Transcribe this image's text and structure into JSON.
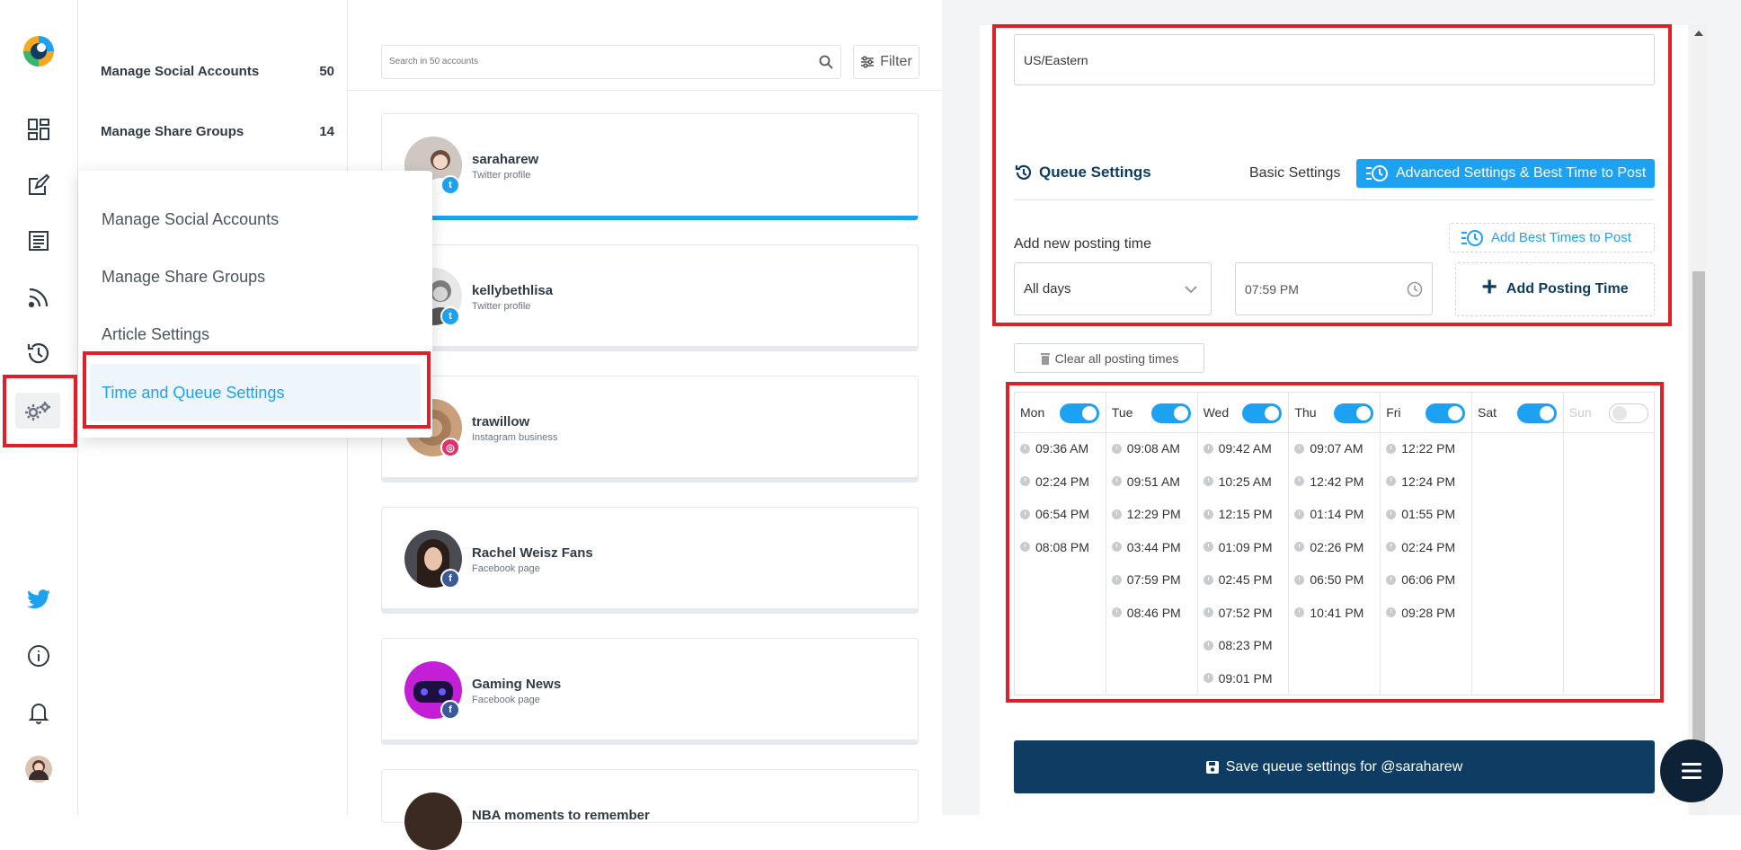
{
  "colors": {
    "accent": "#1da1f2",
    "navy": "#0f3c63",
    "highlight": "#e01f26",
    "twitter": "#1da1f2",
    "facebook": "#3b5998",
    "instagram": "#e1306c"
  },
  "rail": {
    "icons": [
      "logo-icon",
      "dashboard-icon",
      "compose-icon",
      "articles-icon",
      "rss-icon",
      "queue-icon",
      "settings-icon",
      "twitter-icon",
      "info-icon",
      "bell-icon",
      "user-avatar"
    ]
  },
  "settings_menu": {
    "items": [
      {
        "label": "Manage Social Accounts",
        "count": "50"
      },
      {
        "label": "Manage Share Groups",
        "count": "14"
      }
    ]
  },
  "dropdown": {
    "items": [
      "Manage Social Accounts",
      "Manage Share Groups",
      "Article Settings",
      "Time and Queue Settings"
    ]
  },
  "accounts": {
    "search_placeholder": "Search in 50 accounts",
    "filter_label": "Filter",
    "list": [
      {
        "name": "saraharew",
        "type": "Twitter profile",
        "network": "twitter"
      },
      {
        "name": "kellybethlisa",
        "type": "Twitter profile",
        "network": "twitter"
      },
      {
        "name": "trawillow",
        "type": "Instagram business",
        "network": "instagram"
      },
      {
        "name": "Rachel Weisz Fans",
        "type": "Facebook page",
        "network": "facebook"
      },
      {
        "name": "Gaming News",
        "type": "Facebook page",
        "network": "facebook"
      },
      {
        "name": "NBA moments to remember",
        "type": "",
        "network": "facebook"
      }
    ]
  },
  "queue": {
    "timezone": "US/Eastern",
    "title": "Queue Settings",
    "basic_label": "Basic Settings",
    "advanced_label": "Advanced Settings & Best Time to Post",
    "add_new_label": "Add new posting time",
    "best_times_label": "Add Best Times to Post",
    "day_select": "All days",
    "time_value": "07:59 PM",
    "add_button": "Add Posting Time",
    "clear_button": "Clear all posting times",
    "save_button": "Save queue settings for @saraharew",
    "days": [
      {
        "name": "Mon",
        "enabled": true,
        "times": [
          "09:36 AM",
          "02:24 PM",
          "06:54 PM",
          "08:08 PM"
        ]
      },
      {
        "name": "Tue",
        "enabled": true,
        "times": [
          "09:08 AM",
          "09:51 AM",
          "12:29 PM",
          "03:44 PM",
          "07:59 PM",
          "08:46 PM"
        ]
      },
      {
        "name": "Wed",
        "enabled": true,
        "times": [
          "09:42 AM",
          "10:25 AM",
          "12:15 PM",
          "01:09 PM",
          "02:45 PM",
          "07:52 PM",
          "08:23 PM",
          "09:01 PM"
        ]
      },
      {
        "name": "Thu",
        "enabled": true,
        "times": [
          "09:07 AM",
          "12:42 PM",
          "01:14 PM",
          "02:26 PM",
          "06:50 PM",
          "10:41 PM"
        ]
      },
      {
        "name": "Fri",
        "enabled": true,
        "times": [
          "12:22 PM",
          "12:24 PM",
          "01:55 PM",
          "02:24 PM",
          "06:06 PM",
          "09:28 PM"
        ]
      },
      {
        "name": "Sat",
        "enabled": true,
        "times": []
      },
      {
        "name": "Sun",
        "enabled": false,
        "times": []
      }
    ]
  }
}
